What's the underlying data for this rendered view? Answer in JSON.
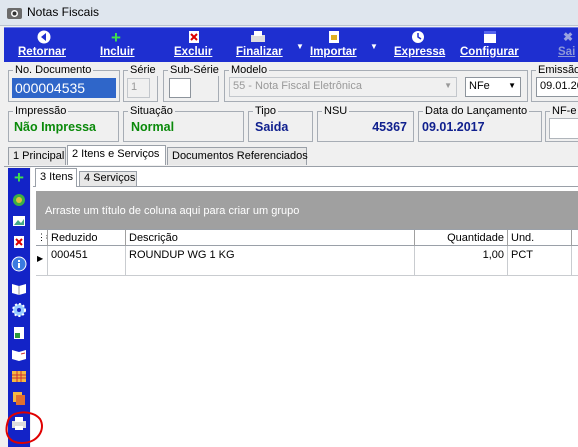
{
  "window": {
    "title": "Notas Fiscais"
  },
  "toolbar": {
    "retornar": "Retornar",
    "incluir": "Incluir",
    "excluir": "Excluir",
    "finalizar": "Finalizar",
    "importar": "Importar",
    "expressa": "Expressa",
    "configurar": "Configurar",
    "sair": "Sai"
  },
  "fields": {
    "no_documento": {
      "label": "No. Documento",
      "value": "000004535"
    },
    "serie": {
      "label": "Série",
      "value": "1"
    },
    "sub_serie": {
      "label": "Sub-Série",
      "value": ""
    },
    "modelo": {
      "label": "Modelo",
      "value": "55 - Nota Fiscal Eletrônica",
      "tipo": "NFe"
    },
    "emissao": {
      "label": "Emissão",
      "value": "09.01.20"
    },
    "impressao": {
      "label": "Impressão",
      "value": "Não Impressa"
    },
    "situacao": {
      "label": "Situação",
      "value": "Normal"
    },
    "tipo": {
      "label": "Tipo",
      "value": "Saida"
    },
    "nsu": {
      "label": "NSU",
      "value": "45367"
    },
    "data_lancamento": {
      "label": "Data do Lançamento",
      "value": "09.01.2017"
    },
    "nfe_status": {
      "label": "NF-e S"
    }
  },
  "tabs": {
    "principal": "1 Principal",
    "itens_servicos": "2 Itens e Serviços",
    "documentos": "Documentos Referenciados"
  },
  "subtabs": {
    "itens": "3 Itens",
    "servicos": "4 Serviços"
  },
  "grid": {
    "group_hint": "Arraste um título de coluna aqui para criar um grupo",
    "columns": {
      "reduzido": "Reduzido",
      "descricao": "Descrição",
      "quantidade": "Quantidade",
      "und": "Und."
    },
    "rows": [
      {
        "reduzido": "000451",
        "descricao": "ROUNDUP WG 1 KG",
        "quantidade": "1,00",
        "und": "PCT"
      }
    ]
  },
  "colors": {
    "toolbar_bg": "#1e2fd0",
    "sidebar_bg": "#1323c7",
    "status_green": "#0a8a0a",
    "status_blue": "#10208e",
    "annotation_red": "#e00000"
  }
}
